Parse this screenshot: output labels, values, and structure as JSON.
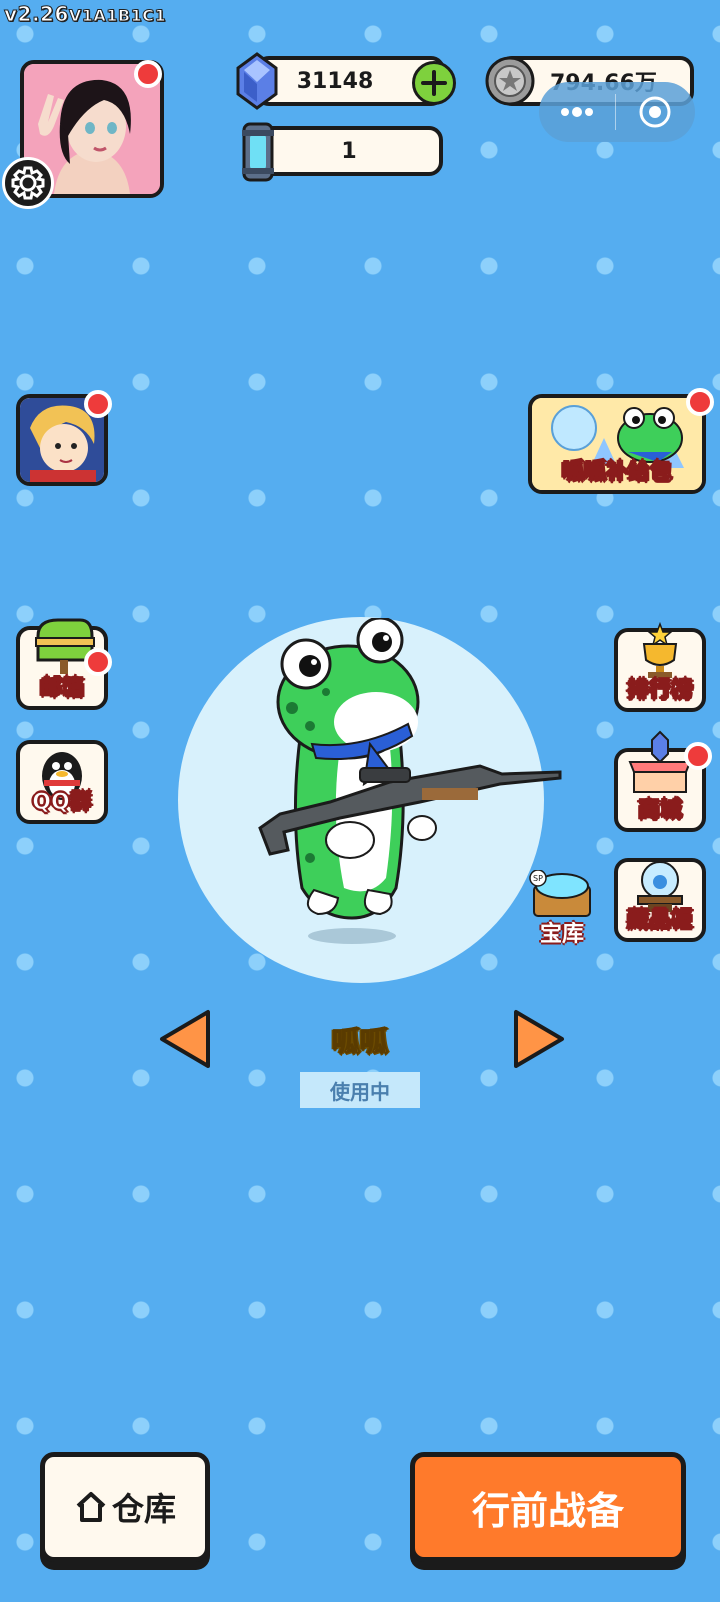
{
  "version": {
    "main": "v2.26",
    "suffix": "V1A1B1C1"
  },
  "currency": {
    "gems": "31148",
    "coins": "794.66万",
    "tickets": "1"
  },
  "side_menu": {
    "mail": "邮箱",
    "qq_group": "QQ群",
    "supply_pack": "呱呱补给包",
    "leaderboard": "排行榜",
    "shop": "商城",
    "vault": "宝库",
    "collection": "藏品柜"
  },
  "character": {
    "name": "呱呱",
    "status": "使用中"
  },
  "bottom": {
    "warehouse": "仓库",
    "prepare": "行前战备"
  },
  "colors": {
    "background": "#55adf0",
    "accent_orange": "#ff7a2b",
    "notification_red": "#ee3b3b",
    "frog_green": "#3ecf5a"
  }
}
